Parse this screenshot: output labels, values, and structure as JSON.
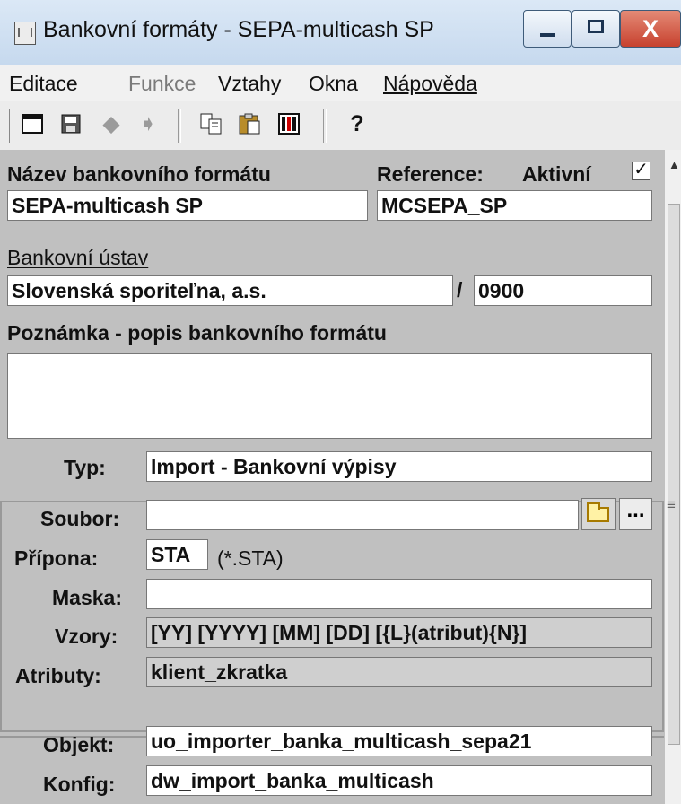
{
  "window": {
    "title": "Bankovní formáty - SEPA-multicash SP",
    "controls": {
      "minimize": "−",
      "maximize": "□",
      "close": "X"
    }
  },
  "menu": {
    "items": [
      "Editace",
      "Funkce",
      "Vztahy",
      "Okna",
      "Nápověda"
    ]
  },
  "toolbar": {
    "icons": [
      "new-window-icon",
      "save-icon",
      "back-arrow-icon",
      "forward-arrow-icon",
      "copy-icon",
      "paste-icon",
      "grid-icon",
      "help-icon"
    ]
  },
  "form": {
    "labels": {
      "format_name": "Název bankovního formátu",
      "reference": "Reference:",
      "active": "Aktivní",
      "bank": "Bankovní ústav",
      "bank_sep": "/",
      "note": "Poznámka - popis bankovního formátu",
      "type": "Typ:",
      "file": "Soubor:",
      "extension": "Přípona:",
      "mask": "Maska:",
      "patterns": "Vzory:",
      "attributes": "Atributy:",
      "object": "Objekt:",
      "config": "Konfig:"
    },
    "values": {
      "format_name": "SEPA-multicash SP",
      "reference": "MCSEPA_SP",
      "active_checked": "✓",
      "bank_name": "Slovenská sporiteľna, a.s.",
      "bank_code": "0900",
      "note": "",
      "type": "Import - Bankovní výpisy",
      "file": "",
      "extension": "STA",
      "extension_hint": "(*.STA)",
      "mask": "",
      "patterns": "[YY] [YYYY] [MM] [DD] [{L}(atribut){N}]",
      "attributes": "klient_zkratka",
      "object": "uo_importer_banka_multicash_sepa21",
      "config": "dw_import_banka_multicash"
    },
    "buttons": {
      "browse_dots": "..."
    }
  },
  "scrollbar": {
    "up_arrow": "▲",
    "thumb_grip": "≡"
  }
}
